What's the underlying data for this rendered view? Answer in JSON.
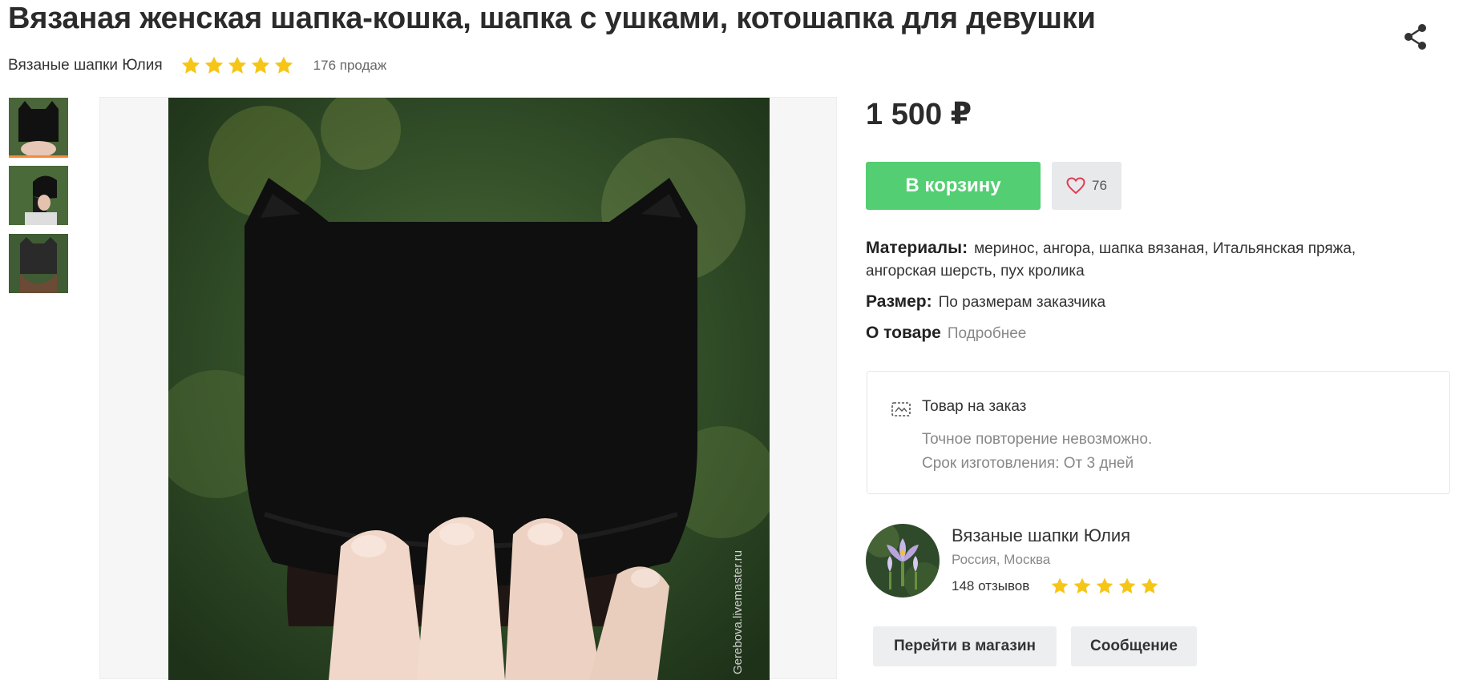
{
  "product": {
    "title": "Вязаная женская шапка-кошка, шапка с ушками, котошапка для девушки",
    "shop_name": "Вязаные шапки Юлия",
    "rating": 5,
    "sales": "176 продаж",
    "price": "1 500 ₽",
    "watermark": "Gerebova.livemaster.ru"
  },
  "actions": {
    "cart_label": "В корзину",
    "favorites_count": "76"
  },
  "properties": {
    "materials_label": "Материалы:",
    "materials_value": "меринос, ангора, шапка вязаная, Итальянская пряжа, ангорская шерсть, пух кролика",
    "size_label": "Размер:",
    "size_value": "По размерам заказчика",
    "about_label": "О товаре",
    "about_link": "Подробнее"
  },
  "order": {
    "title": "Товар на заказ",
    "line1": "Точное повторение невозможно.",
    "line2": "Срок изготовления: От 3 дней"
  },
  "seller": {
    "name": "Вязаные шапки Юлия",
    "location": "Россия, Москва",
    "reviews": "148 отзывов",
    "rating": 5,
    "go_to_shop": "Перейти в магазин",
    "message": "Сообщение"
  },
  "colors": {
    "accent_green": "#54ce72",
    "star_yellow": "#f5c518",
    "active_thumb": "#f7893b"
  },
  "icons": [
    "share-icon",
    "heart-icon",
    "made-to-order-icon",
    "star-icon"
  ]
}
